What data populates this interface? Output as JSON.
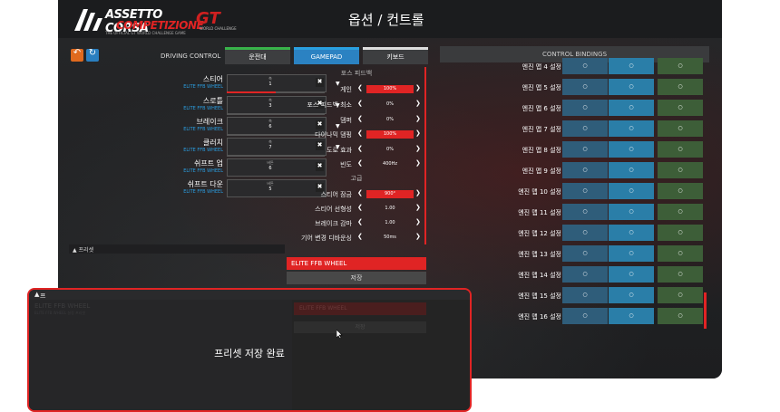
{
  "header": {
    "logo_line1": "ASSETTO CORSA",
    "logo_line2": "COMPETIZIONE",
    "logo_tagline": "THE OFFICIAL GT WORLD CHALLENGE GAME",
    "gt_logo": "GT",
    "gt_tagline": "WORLD CHALLENGE",
    "title": "옵션 / 컨트롤"
  },
  "toolbar": {
    "driving_control_label": "DRIVING CONTROL",
    "tabs": [
      "운전대",
      "GAMEPAD",
      "키보드"
    ],
    "undo_icon": "undo-icon",
    "refresh_icon": "refresh-icon"
  },
  "controls": [
    {
      "name": "스티어",
      "sub": "ELITE FFB WHEEL",
      "box_top": "축",
      "box_val": "1",
      "fill": 0.5
    },
    {
      "name": "스로틀",
      "sub": "ELITE FFB WHEEL",
      "box_top": "축",
      "box_val": "3",
      "fill": 0.0
    },
    {
      "name": "브레이크",
      "sub": "ELITE FFB WHEEL",
      "box_top": "축",
      "box_val": "6",
      "fill": 0.0
    },
    {
      "name": "클러치",
      "sub": "ELITE FFB WHEEL",
      "box_top": "축",
      "box_val": "7",
      "fill": 0.0
    },
    {
      "name": "쉬프트 업",
      "sub": "ELITE FFB WHEEL",
      "box_top": "버튼",
      "box_val": "6",
      "fill": null
    },
    {
      "name": "쉬프트 다운",
      "sub": "ELITE FFB WHEEL",
      "box_top": "버튼",
      "box_val": "5",
      "fill": null
    }
  ],
  "ffb": {
    "header": "포스 피드백",
    "advanced_header": "고급",
    "rows": [
      {
        "label": "게인",
        "value": "100%",
        "highlight": true
      },
      {
        "label": "포스 피드백 최소",
        "value": "0%",
        "highlight": false
      },
      {
        "label": "댐퍼",
        "value": "0%",
        "highlight": false
      },
      {
        "label": "다이나믹 댐핑",
        "value": "100%",
        "highlight": true
      },
      {
        "label": "도로 효과",
        "value": "0%",
        "highlight": false
      },
      {
        "label": "빈도",
        "value": "400Hz",
        "highlight": false
      }
    ],
    "advanced_rows": [
      {
        "label": "스티어 잠금",
        "value": "900°",
        "highlight": true
      },
      {
        "label": "스티어 선형성",
        "value": "1.00",
        "highlight": false
      },
      {
        "label": "브레이크 감마",
        "value": "1.00",
        "highlight": false
      },
      {
        "label": "기어 변경 디바운싱",
        "value": "50ms",
        "highlight": false
      }
    ]
  },
  "preset": {
    "label": "프리셋",
    "device": "ELITE FFB WHEEL",
    "save": "저장"
  },
  "bindings": {
    "title": "CONTROL BINDINGS",
    "rows": [
      "엔진 맵 4 설정",
      "엔진 맵 5 설정",
      "엔진 맵 6 설정",
      "엔진 맵 7 설정",
      "엔진 맵 8 설정",
      "엔진 맵 9 설정",
      "엔진 맵 10 설정",
      "엔진 맵 11 설정",
      "엔진 맵 12 설정",
      "엔진 맵 13 설정",
      "엔진 맵 14 설정",
      "엔진 맵 15 설정",
      "엔진 맵 16 설정"
    ],
    "cell": "○"
  },
  "dialog": {
    "header": "프리셋",
    "ghost_device": "ELITE FFB WHEEL",
    "ghost_sub": "ELITE FFB WHEEL 설정 프리셋",
    "ghost_red": "ELITE FFB WHEEL",
    "ghost_save": "저장",
    "message": "프리셋 저장 완료"
  },
  "colors": {
    "accent_red": "#e02424",
    "accent_blue": "#2b82c2",
    "green": "#38b34a"
  }
}
